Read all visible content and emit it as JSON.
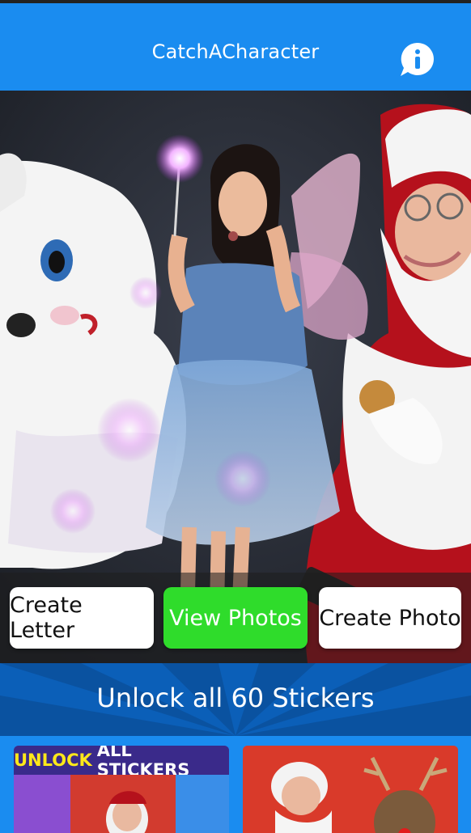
{
  "header": {
    "title": "CatchACharacter",
    "info_icon": "info-icon",
    "color": "#1a8cf0"
  },
  "actions": {
    "create_letter": "Create Letter",
    "view_photos": "View Photos",
    "create_photo": "Create Photo",
    "view_photos_color": "#2fdc2b"
  },
  "unlock": {
    "label": "Unlock all 60 Stickers"
  },
  "cards": {
    "left": {
      "banner_highlight": "UNLOCK",
      "banner_rest": "ALL STICKERS"
    }
  }
}
